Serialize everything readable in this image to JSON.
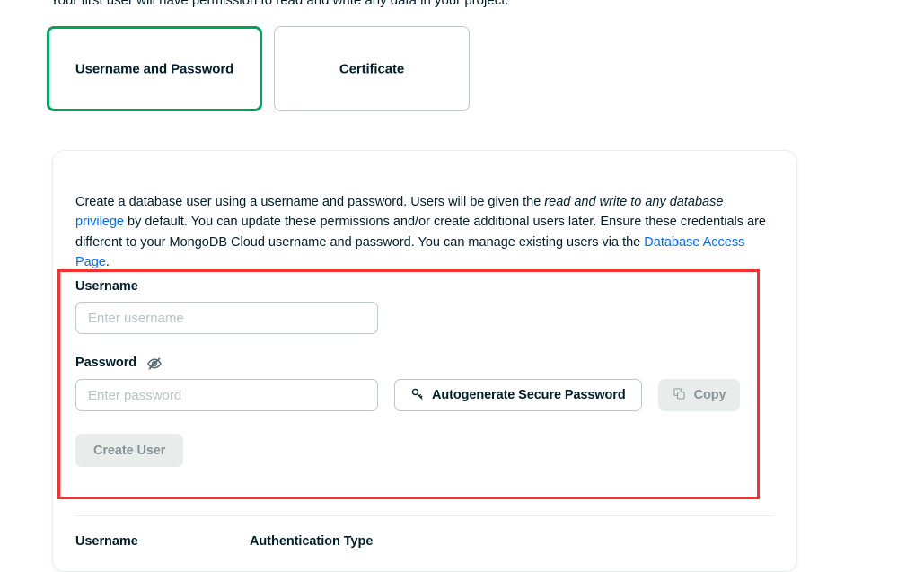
{
  "intro": {
    "text": "Your first user will have permission to read and write any data in your project."
  },
  "auth_tabs": [
    {
      "label": "Username and Password",
      "selected": true
    },
    {
      "label": "Certificate",
      "selected": false
    }
  ],
  "panel": {
    "description": {
      "part1": "Create a database user using a username and password. Users will be given the ",
      "italic": "read and write to any database",
      "part2": " ",
      "link1": "privilege",
      "part3": " by default. You can update these permissions and/or create additional users later. Ensure these credentials are different to your MongoDB Cloud username and password. You can manage existing users via the ",
      "link2": "Database Access Page",
      "part4": "."
    },
    "form": {
      "username_label": "Username",
      "username_value": "",
      "username_placeholder": "Enter username",
      "password_label": "Password",
      "password_toggle_icon": "eye-off-icon",
      "password_value": "",
      "password_placeholder": "Enter password",
      "autogenerate_label": "Autogenerate Secure Password",
      "autogenerate_icon": "key-icon",
      "copy_label": "Copy",
      "copy_icon": "copy-icon",
      "copy_disabled": true,
      "create_user_label": "Create User",
      "create_user_disabled": true
    },
    "table": {
      "columns": [
        "Username",
        "Authentication Type"
      ]
    }
  },
  "colors": {
    "brand_green": "#00a35c",
    "link_blue": "#016bf8",
    "annotation_red": "#f8312f",
    "text_dark": "#001e2b",
    "border_grey": "#c1c7c6",
    "disabled_bg": "#e8edeb",
    "disabled_text": "#889397",
    "placeholder": "#b8c4c2"
  }
}
